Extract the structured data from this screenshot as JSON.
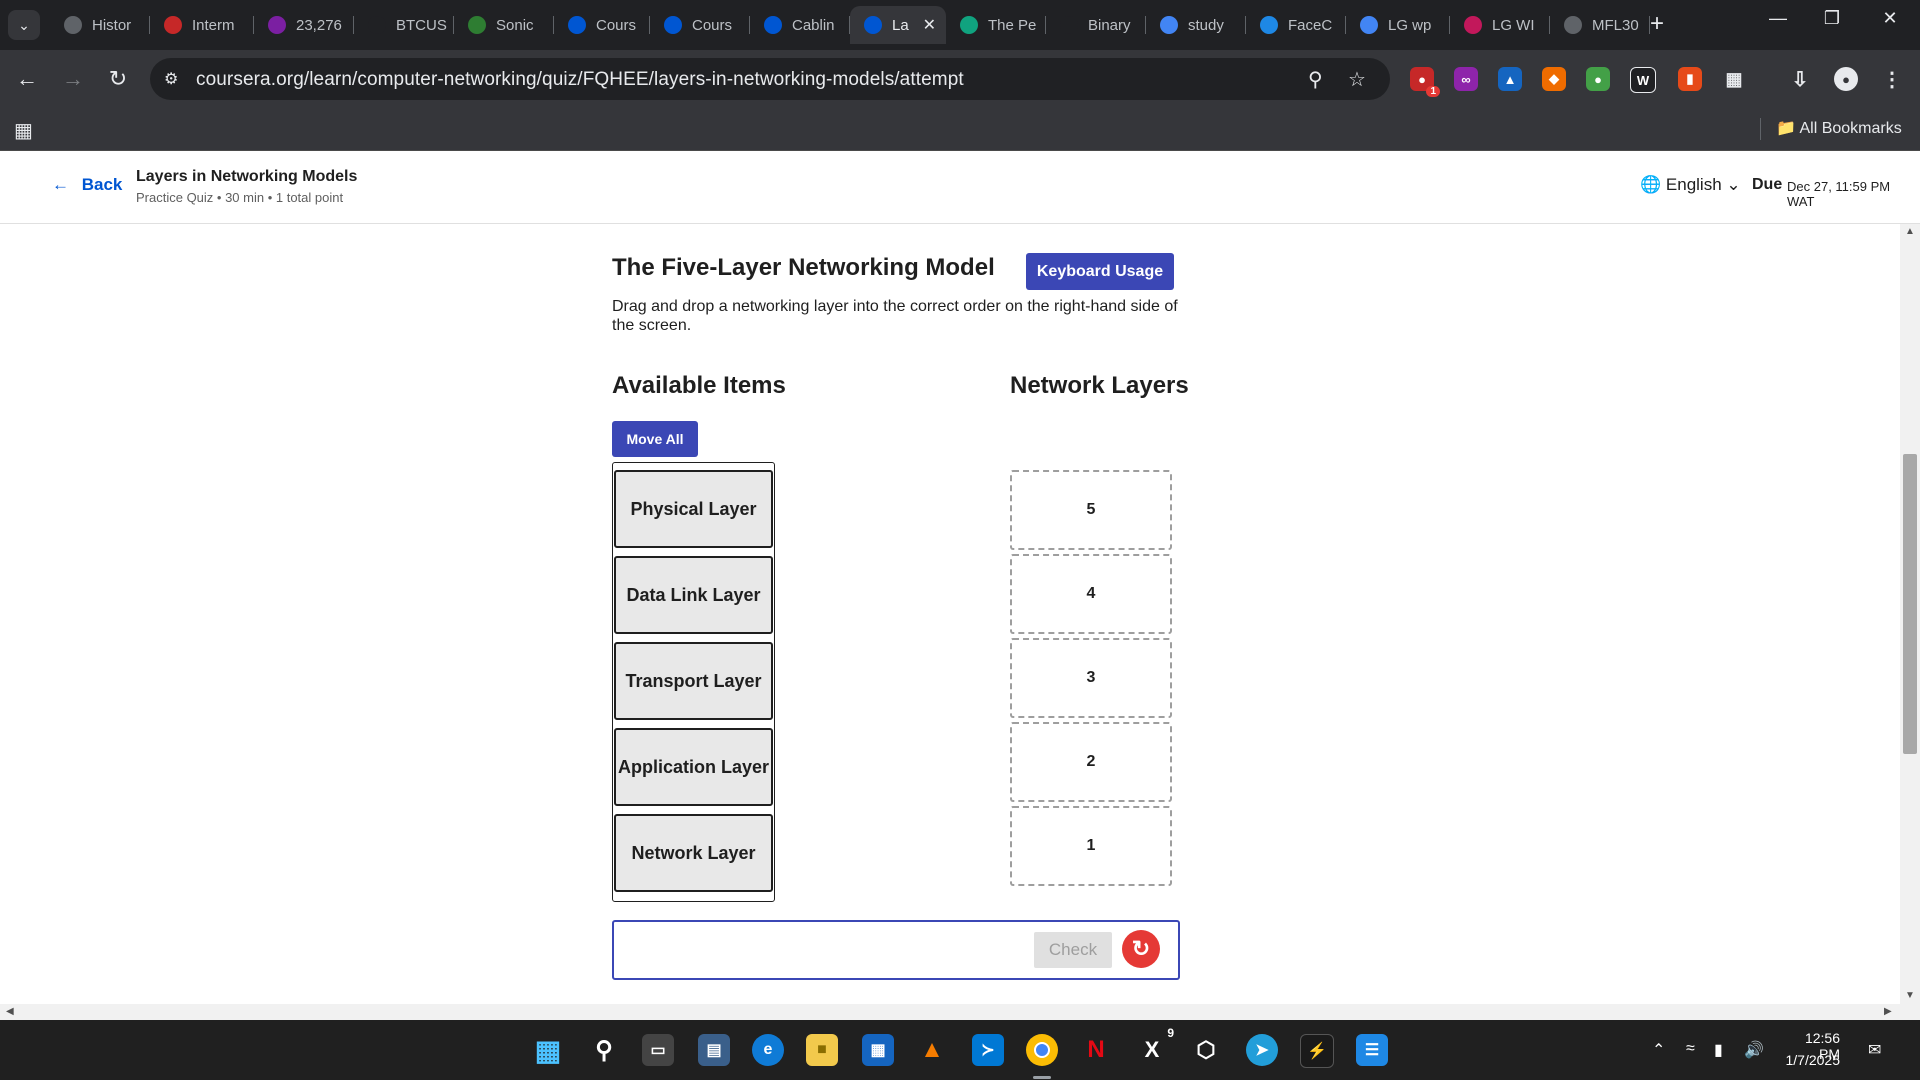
{
  "browser": {
    "tabs": [
      {
        "label": "Histor",
        "favicon": "history-icon",
        "color": "#5f6368"
      },
      {
        "label": "Interm",
        "favicon": "speedometer-icon",
        "color": "#c62828"
      },
      {
        "label": "23,276",
        "favicon": "mail-icon",
        "color": "#7b1fa2"
      },
      {
        "label": "BTCUS",
        "favicon": "tradingview-icon",
        "color": "#202124"
      },
      {
        "label": "Sonic",
        "favicon": "sonic-icon",
        "color": "#2e7d32"
      },
      {
        "label": "Cours",
        "favicon": "coursera-icon",
        "color": "#0056d2"
      },
      {
        "label": "Cours",
        "favicon": "coursera-icon",
        "color": "#0056d2"
      },
      {
        "label": "Cablin",
        "favicon": "coursera-icon",
        "color": "#0056d2"
      },
      {
        "label": "La",
        "favicon": "coursera-icon",
        "color": "#0056d2",
        "active": true
      },
      {
        "label": "The Pe",
        "favicon": "chatgpt-icon",
        "color": "#10a37f"
      },
      {
        "label": "Binary",
        "favicon": "openai-icon",
        "color": "#202124"
      },
      {
        "label": "study",
        "favicon": "google-icon",
        "color": "#4285f4"
      },
      {
        "label": "FaceC",
        "favicon": "shield-icon",
        "color": "#1e88e5"
      },
      {
        "label": "LG wp",
        "favicon": "google-icon",
        "color": "#4285f4"
      },
      {
        "label": "LG WI",
        "favicon": "lg-icon",
        "color": "#c2185b"
      },
      {
        "label": "MFL30",
        "favicon": "globe-icon",
        "color": "#5f6368"
      }
    ],
    "url": "coursera.org/learn/computer-networking/quiz/FQHEE/layers-in-networking-models/attempt",
    "all_bookmarks": "All Bookmarks",
    "extension_badge": "1"
  },
  "header": {
    "back": "Back",
    "quiz_title": "Layers in Networking Models",
    "quiz_meta": "Practice Quiz • 30 min • 1 total point",
    "language": "English",
    "due_label": "Due",
    "due_date": "Dec 27, 11:59 PM WAT"
  },
  "question": {
    "title": "The Five-Layer Networking Model",
    "keyboard_usage": "Keyboard Usage",
    "instructions": "Drag and drop a networking layer into the correct order on the right-hand side of the screen.",
    "available_heading": "Available Items",
    "layers_heading": "Network Layers",
    "move_all": "Move All",
    "items": [
      "Physical Layer",
      "Data Link Layer",
      "Transport Layer",
      "Application Layer",
      "Network Layer"
    ],
    "slots": [
      "5",
      "4",
      "3",
      "2",
      "1"
    ],
    "check": "Check"
  },
  "taskbar": {
    "time": "12:56 PM",
    "date": "1/7/2025",
    "x_badge": "9"
  }
}
